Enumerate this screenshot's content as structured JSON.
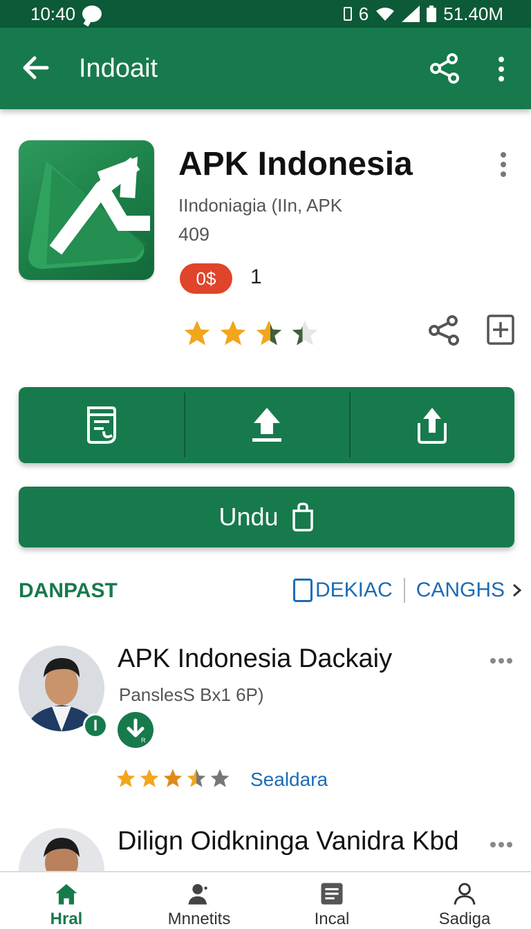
{
  "status_bar": {
    "time": "10:4\u0000",
    "time_text": "10:40",
    "battery_text": "51.40M",
    "signal_text": "6"
  },
  "app_bar": {
    "title": "Indoait"
  },
  "app": {
    "name": "APK Indonesia",
    "subtitle": "IIndoniagia (IIn, APK",
    "version": "409",
    "price_badge": "0$",
    "price_count": "1",
    "rating": 3.5
  },
  "download_button": {
    "label": "Undu"
  },
  "section": {
    "left_label": "DANPAST",
    "right_label_1": "DEKIAC",
    "right_label_2": "CANGHS"
  },
  "list": [
    {
      "title": "APK Indonesia Dackaiy",
      "subtitle": "PanslesS Bx1 6P)",
      "badge": "I",
      "rating": 3.5,
      "link": "Sealdara"
    },
    {
      "title": "Dilign Oidkninga Vanidra Kbd",
      "subtitle": ""
    }
  ],
  "bottom_nav": [
    {
      "label": "Hral",
      "icon": "home-icon",
      "active": true
    },
    {
      "label": "Mnnetits",
      "icon": "person-icon",
      "active": false
    },
    {
      "label": "Incal",
      "icon": "list-icon",
      "active": false
    },
    {
      "label": "Sadiga",
      "icon": "account-icon",
      "active": false
    }
  ],
  "colors": {
    "primary": "#177a4c",
    "status_bar": "#0c5a37",
    "accent_red": "#e0442b",
    "link_blue": "#1d6bb5",
    "star": "#f2a61c"
  }
}
